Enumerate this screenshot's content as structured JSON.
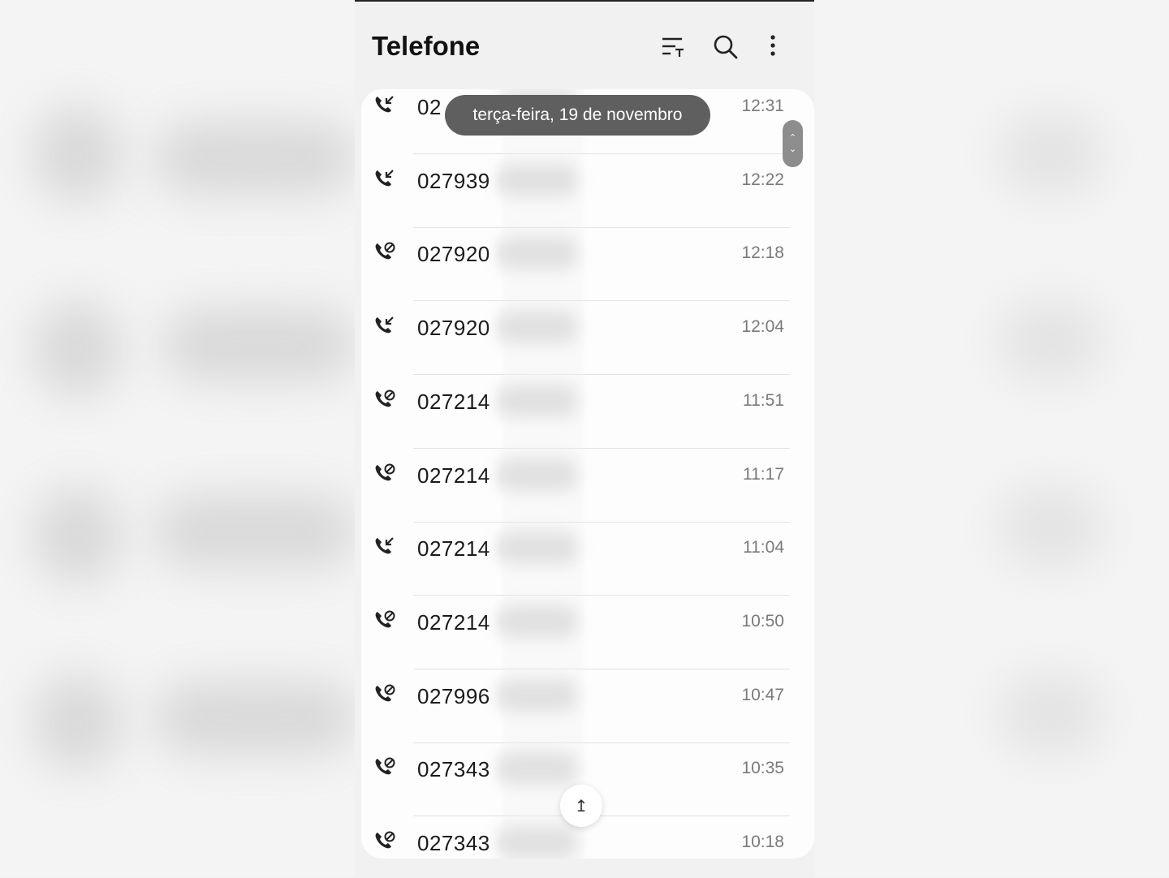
{
  "app": {
    "title": "Telefone"
  },
  "header_icons": [
    "filter-icon",
    "search-icon",
    "more-options-icon"
  ],
  "date_tooltip": "terça-feira, 19 de novembro",
  "scroll_to_top_icon": "arrow-up-icon",
  "calls": [
    {
      "type": "incoming",
      "number": "02",
      "time": "12:31"
    },
    {
      "type": "incoming",
      "number": "027939",
      "time": "12:22"
    },
    {
      "type": "outgoing",
      "number": "027920",
      "time": "12:18"
    },
    {
      "type": "incoming",
      "number": "027920",
      "time": "12:04"
    },
    {
      "type": "outgoing",
      "number": "027214",
      "time": "11:51"
    },
    {
      "type": "outgoing",
      "number": "027214",
      "time": "11:17"
    },
    {
      "type": "incoming",
      "number": "027214",
      "time": "11:04"
    },
    {
      "type": "outgoing",
      "number": "027214",
      "time": "10:50"
    },
    {
      "type": "outgoing",
      "number": "027996",
      "time": "10:47"
    },
    {
      "type": "outgoing",
      "number": "027343",
      "time": "10:35"
    },
    {
      "type": "outgoing",
      "number": "027343",
      "time": "10:18"
    }
  ],
  "colors": {
    "background": "#f1f1f1",
    "card": "#fdfdfd",
    "tooltip": "#5f5f5f"
  }
}
